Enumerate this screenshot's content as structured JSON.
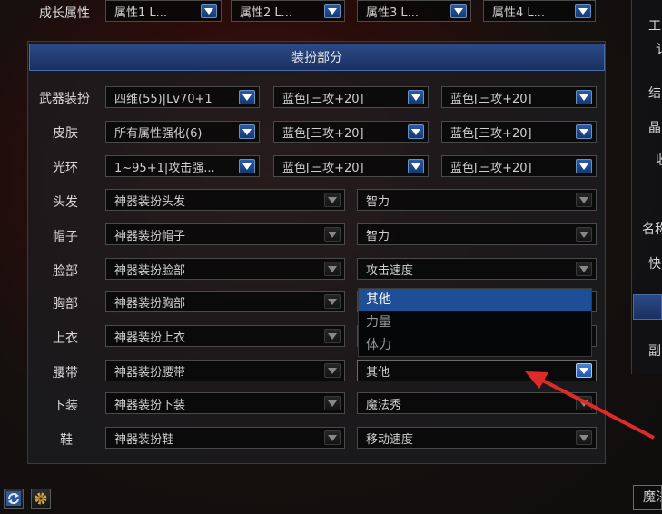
{
  "growth": {
    "label": "成长属性",
    "selects": [
      "属性1 L...",
      "属性2 L...",
      "属性3 L...",
      "属性4 L..."
    ]
  },
  "section": {
    "title": "装扮部分"
  },
  "triple_rows": [
    {
      "label": "武器装扮",
      "values": [
        "四维(55)|Lv70+1",
        "蓝色[三攻+20]",
        "蓝色[三攻+20]"
      ]
    },
    {
      "label": "皮肤",
      "values": [
        "所有属性强化(6)",
        "蓝色[三攻+20]",
        "蓝色[三攻+20]"
      ]
    },
    {
      "label": "光环",
      "values": [
        "1~95+1|攻击强...",
        "蓝色[三攻+20]",
        "蓝色[三攻+20]"
      ]
    }
  ],
  "double_rows": [
    {
      "label": "头发",
      "item": "神器装扮头发",
      "attr": "智力"
    },
    {
      "label": "帽子",
      "item": "神器装扮帽子",
      "attr": "智力"
    },
    {
      "label": "脸部",
      "item": "神器装扮脸部",
      "attr": "攻击速度"
    },
    {
      "label": "胸部",
      "item": "神器装扮胸部",
      "attr": ""
    },
    {
      "label": "上衣",
      "item": "神器装扮上衣",
      "attr": ""
    },
    {
      "label": "腰带",
      "item": "神器装扮腰带",
      "attr": "其他"
    },
    {
      "label": "下装",
      "item": "神器装扮下装",
      "attr": "魔法秀"
    },
    {
      "label": "鞋",
      "item": "神器装扮鞋",
      "attr": "移动速度"
    }
  ],
  "dropdown_open": {
    "options": [
      "其他",
      "力量",
      "体力"
    ],
    "selected": "其他"
  },
  "right_clipped": [
    "工",
    "讠",
    "结",
    "晶",
    "收",
    "名称",
    "快",
    "副"
  ],
  "bottom_right_clipped": "魔法",
  "icons": {
    "refresh": "refresh-icon",
    "settings": "gear-icon"
  },
  "colors": {
    "header_blue": "#1f3a74",
    "accent_arrow": "#e02a2a"
  }
}
